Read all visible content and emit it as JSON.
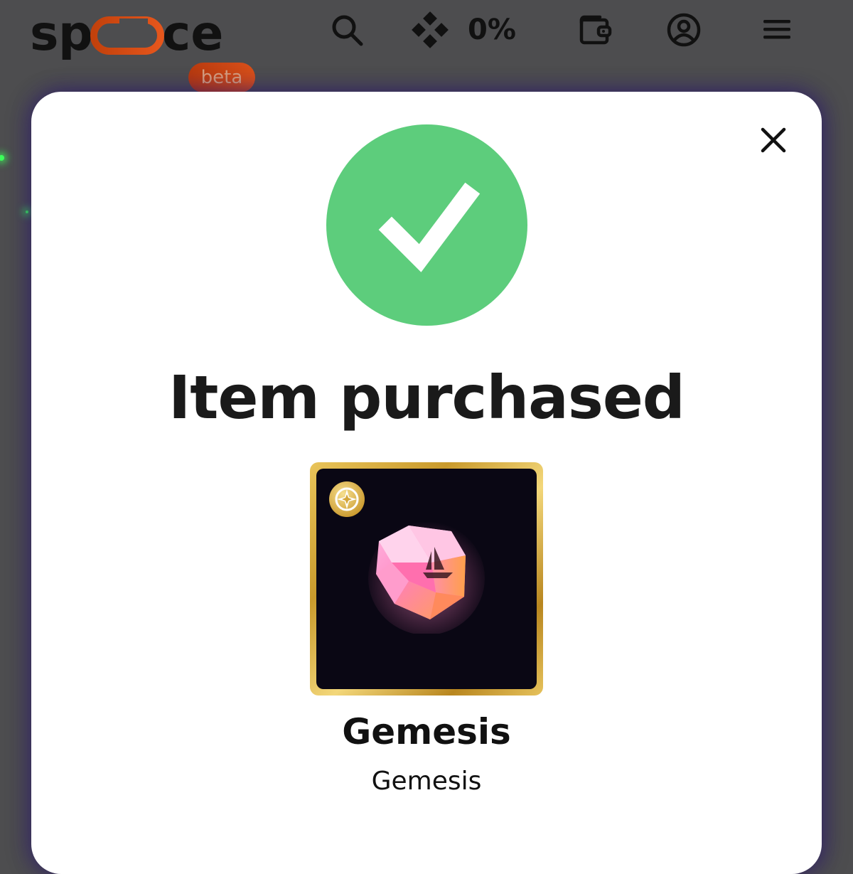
{
  "header": {
    "logo_text": "space",
    "beta_label": "beta",
    "progress_label": "0%",
    "icons": {
      "search": "search-icon",
      "progress": "diamond-cluster-icon",
      "wallet": "wallet-icon",
      "account": "user-circle-icon",
      "menu": "hamburger-menu-icon"
    }
  },
  "modal": {
    "status_icon": "checkmark-icon",
    "title": "Item purchased",
    "close_icon": "close-icon",
    "item": {
      "name": "Gemesis",
      "collection": "Gemesis",
      "rarity_icon": "star-badge-icon"
    }
  },
  "colors": {
    "success": "#5dcd7c",
    "frame_gold": "#e0b84a",
    "beta_badge": "#c8461a",
    "background": "#4d4d4f"
  }
}
